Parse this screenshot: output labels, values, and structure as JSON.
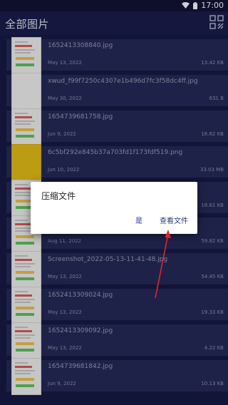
{
  "status_bar": {
    "time": "17:00"
  },
  "header": {
    "title": "全部图片",
    "view_icon": "grid-view-icon"
  },
  "files": [
    {
      "name": "1652413308840.jpg",
      "date": "May 13, 2022",
      "size": "13.42 KB",
      "thumb": "receipt"
    },
    {
      "name": "xwud_f99f7250c4307e1b496d7fc3f58dc4ff.jpg",
      "date": "May 30, 2022",
      "size": "631 B",
      "thumb": "blank"
    },
    {
      "name": "1654739681758.jpg",
      "date": "Jun 9, 2022",
      "size": "16.62 KB",
      "thumb": "receipt"
    },
    {
      "name": "6c5bf292e845b37a703fd1f173fdf519.png",
      "date": "Jun 10, 2022",
      "size": "33.03 MB",
      "thumb": "yellow"
    },
    {
      "name": "",
      "date": "",
      "size": "18.61 KB",
      "thumb": "receipt"
    },
    {
      "name": "",
      "date": "Aug 11, 2022",
      "size": "59.82 KB",
      "thumb": "receipt"
    },
    {
      "name": "Screenshot_2022-05-13-11-41-48.jpg",
      "date": "May 13, 2022",
      "size": "54.45 KB",
      "thumb": "receipt"
    },
    {
      "name": "1652413309024.jpg",
      "date": "May 13, 2022",
      "size": "19.33 KB",
      "thumb": "receipt"
    },
    {
      "name": "1652413309092.jpg",
      "date": "May 13, 2022",
      "size": "4.22 KB",
      "thumb": "receipt"
    },
    {
      "name": "1654739681842.jpg",
      "date": "Jun 9, 2022",
      "size": "10.13 KB",
      "thumb": "receipt"
    }
  ],
  "dialog": {
    "title": "压缩文件",
    "yes_label": "是",
    "view_label": "查看文件"
  },
  "annotation": {
    "color": "#e0262b",
    "target": "view-files-button"
  }
}
